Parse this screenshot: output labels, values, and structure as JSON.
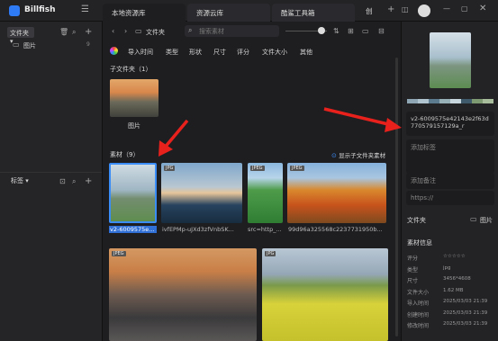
{
  "app": {
    "name": "Billfish"
  },
  "tabs": [
    {
      "label": "本地资源库"
    },
    {
      "label": "资源云库"
    },
    {
      "label": "酷鲨工具箱"
    }
  ],
  "tab_extra": "创",
  "sidebar": {
    "folders_label": "文件夹",
    "folder_items": [
      {
        "name": "图片",
        "count": "9"
      }
    ],
    "tags_label": "标签"
  },
  "toolbar": {
    "breadcrumb": "文件夹",
    "search_placeholder": "搜索素材"
  },
  "filters": [
    "导入时间",
    "类型",
    "形状",
    "尺寸",
    "评分",
    "文件大小",
    "其他"
  ],
  "subfolders": {
    "header": "子文件夹（1）",
    "items": [
      {
        "name": "图片"
      }
    ]
  },
  "assets": {
    "header": "素材（9）",
    "show_sub": "显示子文件夹素材",
    "items": [
      {
        "name": "v2-6009575e...",
        "badge": ""
      },
      {
        "name": "ivfEPMp-uJXd3zfVnbSK...",
        "badge": "JPG"
      },
      {
        "name": "src=http_...",
        "badge": "JPEG"
      },
      {
        "name": "99d96a325568c2237731950b...",
        "badge": "JPEG"
      },
      {
        "name": "",
        "badge": "JPEG"
      },
      {
        "name": "",
        "badge": "JPG"
      }
    ]
  },
  "details": {
    "filename": "v2-6009575e42143e2f63d770579157129a_r",
    "tag_placeholder": "添加标签",
    "note_placeholder": "添加备注",
    "url_placeholder": "https://",
    "folder_label": "文件夹",
    "info_label": "素材信息",
    "palette": [
      "#8fa6b5",
      "#b0c4d0",
      "#5c7b8f",
      "#97b0b8",
      "#c7d6dc",
      "#3f5a6a",
      "#7e9a72",
      "#a7bd9c"
    ],
    "info": [
      {
        "k": "评分",
        "v": "☆☆☆☆☆"
      },
      {
        "k": "类型",
        "v": "jpg"
      },
      {
        "k": "尺寸",
        "v": "3456*4608"
      },
      {
        "k": "文件大小",
        "v": "1.62 MB"
      },
      {
        "k": "导入时间",
        "v": "2025/03/03 21:39"
      },
      {
        "k": "创建时间",
        "v": "2025/03/03 21:39"
      },
      {
        "k": "修改时间",
        "v": "2025/03/03 21:39"
      }
    ]
  }
}
